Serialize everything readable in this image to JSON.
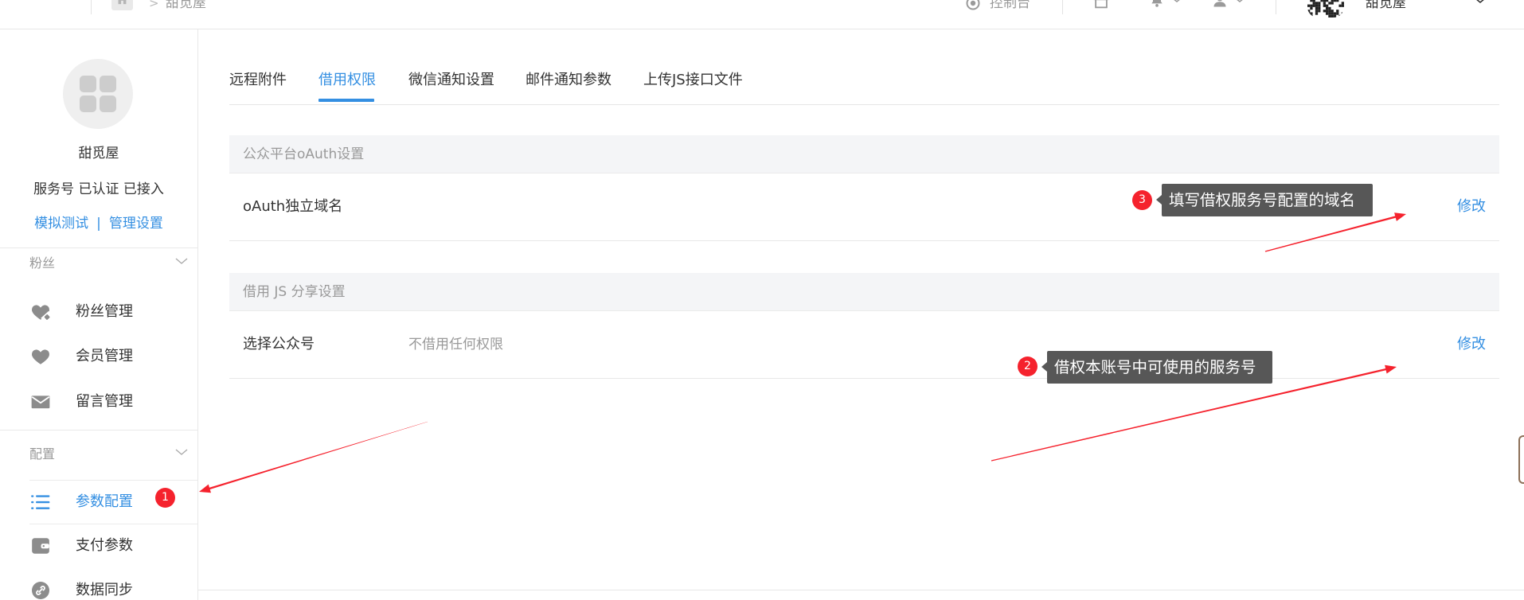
{
  "header": {
    "breadcrumb_separator": ">",
    "breadcrumb_current": "甜觅屋",
    "console_label": "控制台",
    "account_name": "甜觅屋",
    "icons": [
      "home-icon",
      "console-icon",
      "store-icon",
      "bell-icon",
      "user-icon",
      "qr-code-avatar",
      "chevron-down-icon"
    ]
  },
  "sidebar": {
    "account": {
      "name": "甜觅屋",
      "status": "服务号 已认证 已接入",
      "link_test": "模拟测试",
      "link_separator": "|",
      "link_manage": "管理设置"
    },
    "groups": [
      {
        "title": "粉丝",
        "items": [
          {
            "label": "粉丝管理",
            "icon": "fans-manage-icon"
          },
          {
            "label": "会员管理",
            "icon": "heart-icon"
          },
          {
            "label": "留言管理",
            "icon": "mail-icon"
          }
        ]
      },
      {
        "title": "配置",
        "items": [
          {
            "label": "参数配置",
            "icon": "list-icon",
            "active": true
          },
          {
            "label": "支付参数",
            "icon": "wallet-icon"
          },
          {
            "label": "数据同步",
            "icon": "link-icon"
          }
        ]
      }
    ]
  },
  "tabs": [
    {
      "label": "远程附件"
    },
    {
      "label": "借用权限",
      "active": true
    },
    {
      "label": "微信通知设置"
    },
    {
      "label": "邮件通知参数"
    },
    {
      "label": "上传JS接口文件"
    }
  ],
  "sections": [
    {
      "title": "公众平台oAuth设置",
      "rows": [
        {
          "label": "oAuth独立域名",
          "action": "修改"
        }
      ]
    },
    {
      "title": "借用 JS 分享设置",
      "rows": [
        {
          "label": "选择公众号",
          "value": "不借用任何权限",
          "action": "修改"
        }
      ]
    }
  ],
  "annotations": [
    {
      "number": "1"
    },
    {
      "number": "2",
      "text": "借权本账号中可使用的服务号"
    },
    {
      "number": "3",
      "text": "填写借权服务号配置的域名"
    }
  ],
  "colors": {
    "accent": "#348fe2",
    "annotation_red": "#f5222d",
    "tooltip_bg": "#575757",
    "section_header_bg": "#f4f5f7"
  }
}
